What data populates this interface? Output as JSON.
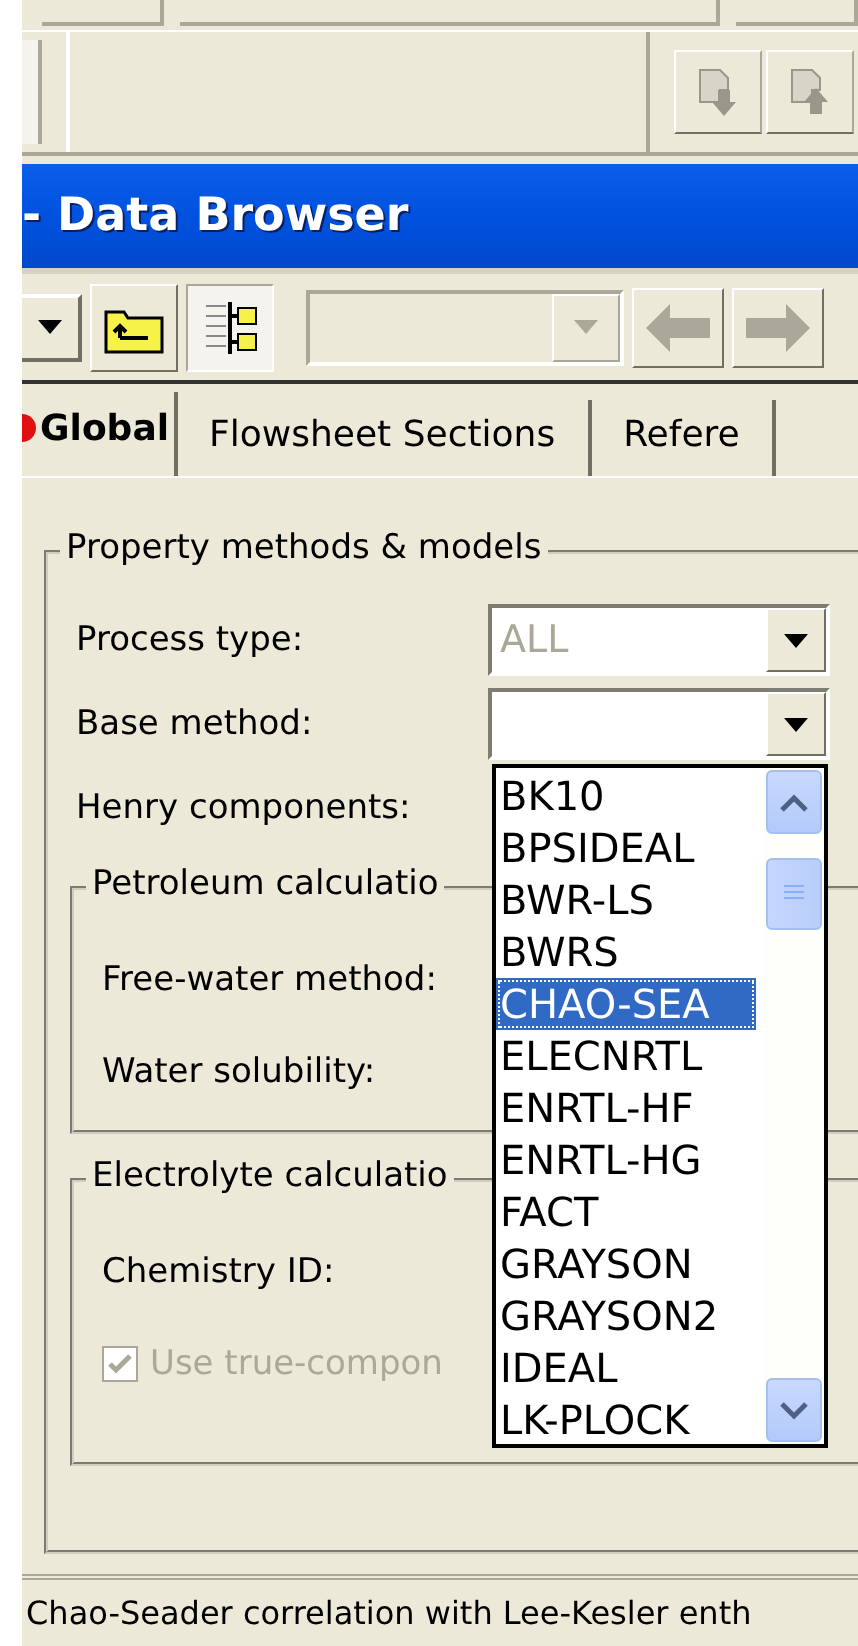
{
  "title_bar": {
    "title": "- Data Browser"
  },
  "tabs": [
    {
      "label": "Global",
      "selected": true
    },
    {
      "label": "Flowsheet Sections",
      "selected": false
    },
    {
      "label": "Refere",
      "selected": false
    }
  ],
  "group": {
    "title": "Property methods & models",
    "fields": [
      {
        "label": "Process type:",
        "value": "ALL",
        "disabled": true
      },
      {
        "label": "Base method:"
      },
      {
        "label": "Henry components:"
      }
    ]
  },
  "petroleum": {
    "title": "Petroleum calculatio",
    "fields": [
      {
        "label": "Free-water method:"
      },
      {
        "label": "Water solubility:"
      }
    ]
  },
  "electrolyte": {
    "title": "Electrolyte calculatio",
    "fields": [
      {
        "label": "Chemistry ID:"
      }
    ],
    "checkbox": {
      "label": "Use true-compon",
      "checked": true,
      "disabled": true
    }
  },
  "dropdown": {
    "items": [
      {
        "label": "BK10",
        "selected": false
      },
      {
        "label": "BPSIDEAL",
        "selected": false
      },
      {
        "label": "BWR-LS",
        "selected": false
      },
      {
        "label": "BWRS",
        "selected": false
      },
      {
        "label": "CHAO-SEA",
        "selected": true
      },
      {
        "label": "ELECNRTL",
        "selected": false
      },
      {
        "label": "ENRTL-HF",
        "selected": false
      },
      {
        "label": "ENRTL-HG",
        "selected": false
      },
      {
        "label": "FACT",
        "selected": false
      },
      {
        "label": "GRAYSON",
        "selected": false
      },
      {
        "label": "GRAYSON2",
        "selected": false
      },
      {
        "label": "IDEAL",
        "selected": false
      },
      {
        "label": "LK-PLOCK",
        "selected": false
      }
    ]
  },
  "status_bar": "Chao-Seader correlation with Lee-Kesler enth"
}
